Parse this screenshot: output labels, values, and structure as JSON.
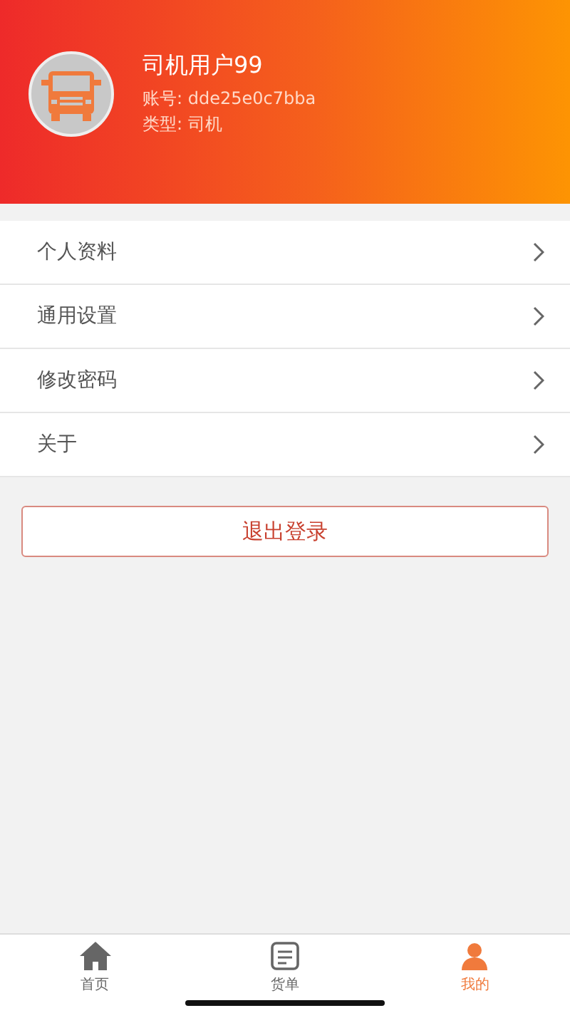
{
  "profile": {
    "name": "司机用户99",
    "account": "账号: dde25e0c7bba",
    "type": "类型: 司机"
  },
  "menu": [
    {
      "label": "个人资料"
    },
    {
      "label": "通用设置"
    },
    {
      "label": "修改密码"
    },
    {
      "label": "关于"
    }
  ],
  "logout_button": "退出登录",
  "tab_bar": [
    {
      "label": "首页",
      "kind": "home",
      "selected": false
    },
    {
      "label": "货单",
      "kind": "list",
      "selected": false
    },
    {
      "label": "我的",
      "kind": "user",
      "selected": true
    }
  ]
}
